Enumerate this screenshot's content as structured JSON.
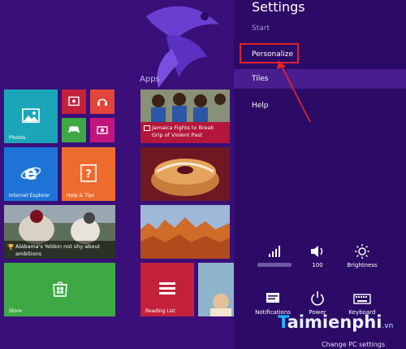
{
  "settings": {
    "title": "Settings",
    "subtitle": "Start",
    "menu": [
      "Personalize",
      "Tiles",
      "Help"
    ],
    "quick": {
      "brightness_label": "Brightness",
      "volume_level": "100",
      "notifications_label": "Notifications",
      "power_label": "Power",
      "keyboard_label": "Keyboard"
    },
    "footer_link": "Change PC settings"
  },
  "start": {
    "apps_label": "Apps",
    "tiles": {
      "photos": "Photos",
      "ie": "Internet Explorer",
      "help": "Help & Tips",
      "store": "Store",
      "reading": "Reading List"
    },
    "news1": "Jamaica Fights to Break Grip of Violent Past",
    "sports1": "Alabama's Yeldon not shy about ambitions"
  },
  "watermark": {
    "brand_main": "aimienphi",
    "brand_t": "T",
    "brand_tld": ".vn"
  },
  "colors": {
    "background": "#3a0f7a",
    "charm": "#2b0b66",
    "highlight": "#e0222c",
    "accent_teal": "#1aa6b8",
    "accent_red": "#e2453b",
    "accent_green": "#3ea944",
    "accent_blue": "#1e74d6"
  }
}
